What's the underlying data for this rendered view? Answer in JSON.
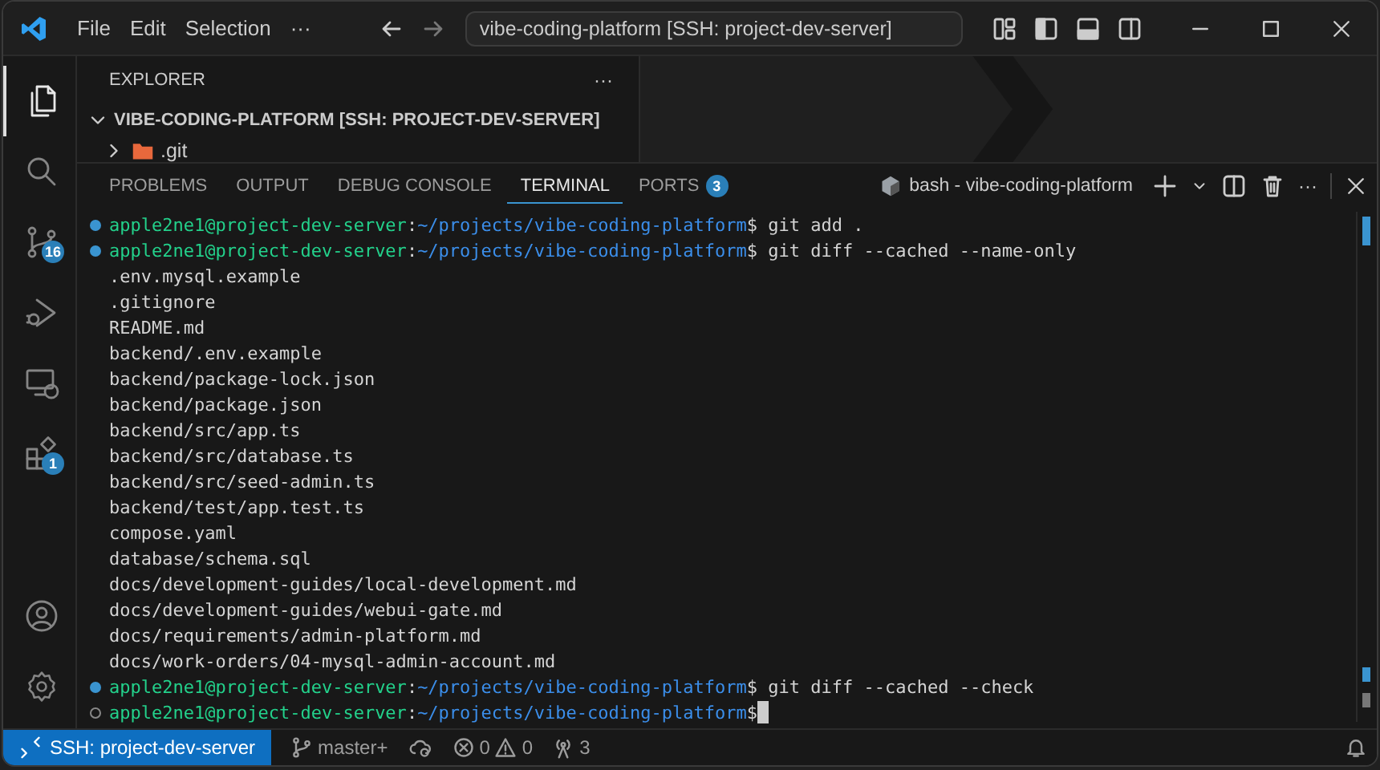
{
  "title_bar": {
    "menus": [
      "File",
      "Edit",
      "Selection",
      "···"
    ],
    "command_center": "vibe-coding-platform [SSH: project-dev-server]"
  },
  "activity_bar": {
    "items": [
      {
        "kind": "files",
        "selected": true
      },
      {
        "kind": "search",
        "selected": false
      },
      {
        "kind": "source-control",
        "selected": false,
        "badge": "16"
      },
      {
        "kind": "debug",
        "selected": false
      },
      {
        "kind": "remote",
        "selected": false
      },
      {
        "kind": "extensions",
        "selected": false,
        "badge": "1"
      }
    ],
    "bottom": [
      {
        "kind": "account"
      },
      {
        "kind": "settings"
      }
    ]
  },
  "sidebar": {
    "title": "EXPLORER",
    "more": "···",
    "root": {
      "label": "VIBE-CODING-PLATFORM [SSH: PROJECT-DEV-SERVER]",
      "expanded": true,
      "children": [
        {
          "label": ".git",
          "expanded": false
        }
      ]
    }
  },
  "panel": {
    "tabs": [
      {
        "label": "PROBLEMS",
        "selected": false
      },
      {
        "label": "OUTPUT",
        "selected": false
      },
      {
        "label": "DEBUG CONSOLE",
        "selected": false
      },
      {
        "label": "TERMINAL",
        "selected": true
      },
      {
        "label": "PORTS",
        "selected": false,
        "badge": "3"
      }
    ],
    "terminal_name": "bash - vibe-coding-platform",
    "more": "···",
    "terminal": [
      {
        "kind": "prompt",
        "completed": true,
        "user": "apple2ne1@project-dev-server",
        "separator": ":",
        "path": "~/projects/vibe-coding-platform",
        "symbol": "$",
        "command": "git add .",
        "cursor": false
      },
      {
        "kind": "prompt",
        "completed": true,
        "user": "apple2ne1@project-dev-server",
        "separator": ":",
        "path": "~/projects/vibe-coding-platform",
        "symbol": "$",
        "command": "git diff --cached --name-only",
        "cursor": false
      },
      {
        "kind": "output",
        "text": ".env.mysql.example"
      },
      {
        "kind": "output",
        "text": ".gitignore"
      },
      {
        "kind": "output",
        "text": "README.md"
      },
      {
        "kind": "output",
        "text": "backend/.env.example"
      },
      {
        "kind": "output",
        "text": "backend/package-lock.json"
      },
      {
        "kind": "output",
        "text": "backend/package.json"
      },
      {
        "kind": "output",
        "text": "backend/src/app.ts"
      },
      {
        "kind": "output",
        "text": "backend/src/database.ts"
      },
      {
        "kind": "output",
        "text": "backend/src/seed-admin.ts"
      },
      {
        "kind": "output",
        "text": "backend/test/app.test.ts"
      },
      {
        "kind": "output",
        "text": "compose.yaml"
      },
      {
        "kind": "output",
        "text": "database/schema.sql"
      },
      {
        "kind": "output",
        "text": "docs/development-guides/local-development.md"
      },
      {
        "kind": "output",
        "text": "docs/development-guides/webui-gate.md"
      },
      {
        "kind": "output",
        "text": "docs/requirements/admin-platform.md"
      },
      {
        "kind": "output",
        "text": "docs/work-orders/04-mysql-admin-account.md"
      },
      {
        "kind": "prompt",
        "completed": true,
        "user": "apple2ne1@project-dev-server",
        "separator": ":",
        "path": "~/projects/vibe-coding-platform",
        "symbol": "$",
        "command": "git diff --cached --check",
        "cursor": false
      },
      {
        "kind": "prompt",
        "completed": false,
        "user": "apple2ne1@project-dev-server",
        "separator": ":",
        "path": "~/projects/vibe-coding-platform",
        "symbol": "$",
        "cursor": true
      }
    ]
  },
  "status_bar": {
    "remote": "SSH: project-dev-server",
    "branch": "master+",
    "errors": "0",
    "warnings": "0",
    "ports": "3"
  }
}
